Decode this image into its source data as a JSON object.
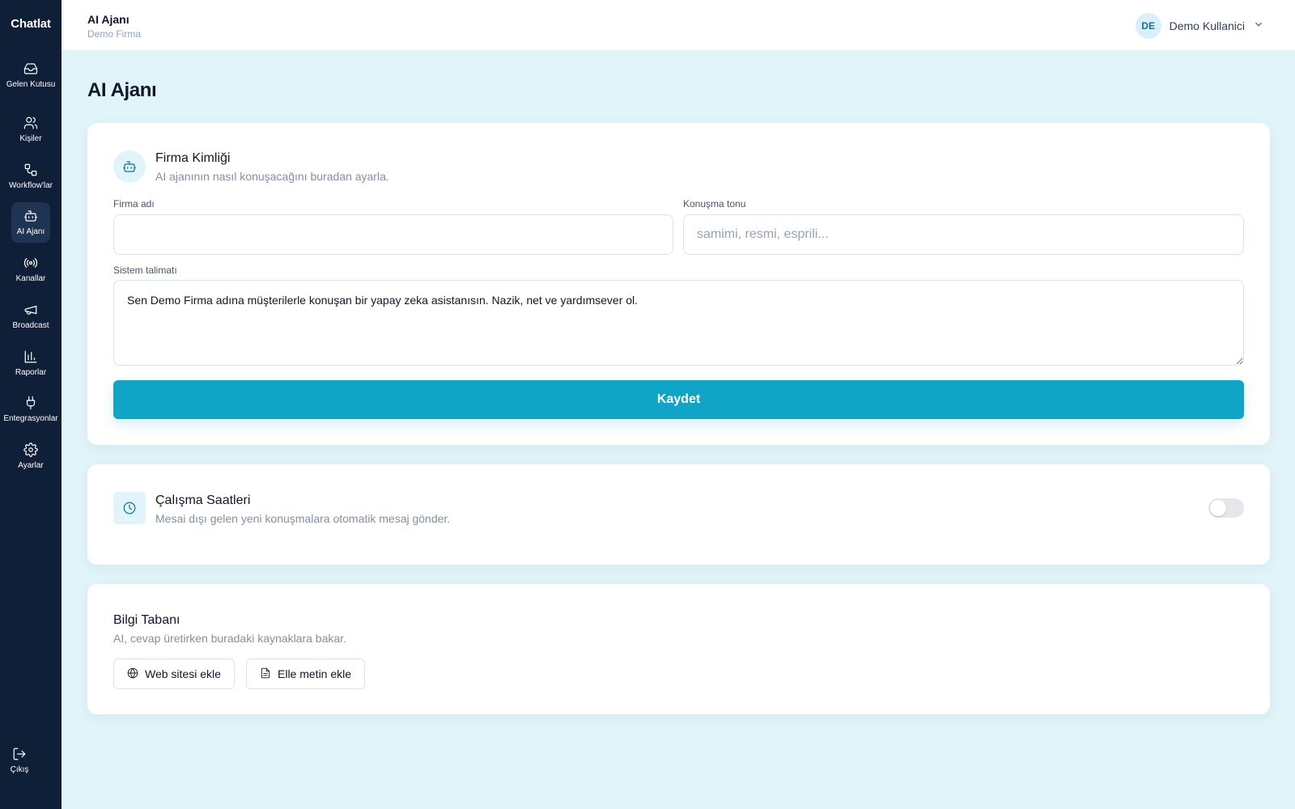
{
  "app": {
    "brand": "Chatlat"
  },
  "sidebar": {
    "items": [
      {
        "label": "Gelen Kutusu",
        "icon": "inbox-icon"
      },
      {
        "label": "Kişiler",
        "icon": "users-icon"
      },
      {
        "label": "Workflow'lar",
        "icon": "workflow-icon"
      },
      {
        "label": "AI Ajanı",
        "icon": "bot-icon",
        "active": true
      },
      {
        "label": "Kanallar",
        "icon": "radio-icon"
      },
      {
        "label": "Broadcast",
        "icon": "megaphone-icon"
      },
      {
        "label": "Raporlar",
        "icon": "bar-chart-icon"
      },
      {
        "label": "Entegrasyonlar",
        "icon": "plug-icon"
      },
      {
        "label": "Ayarlar",
        "icon": "gear-icon"
      }
    ],
    "logout": {
      "label": "Çıkış",
      "icon": "logout-icon"
    }
  },
  "header": {
    "title": "AI Ajanı",
    "subtitle": "Demo Firma",
    "user": {
      "initials": "DE",
      "name": "Demo Kullanici"
    }
  },
  "main": {
    "page_title": "AI Ajanı",
    "identity": {
      "title": "Firma Kimliği",
      "description": "AI ajanının nasıl konuşacağını buradan ayarla.",
      "company_name": {
        "label": "Firma adı",
        "value": "",
        "placeholder": ""
      },
      "tone": {
        "label": "Konuşma tonu",
        "value": "",
        "placeholder": "samimi, resmi, esprili..."
      },
      "system_prompt": {
        "label": "Sistem talimatı",
        "value": "Sen Demo Firma adına müşterilerle konuşan bir yapay zeka asistanısın. Nazik, net ve yardımsever ol."
      },
      "save_label": "Kaydet"
    },
    "working_hours": {
      "title": "Çalışma Saatleri",
      "description": "Mesai dışı gelen yeni konuşmalara otomatik mesaj gönder.",
      "enabled": false
    },
    "knowledge_base": {
      "title": "Bilgi Tabanı",
      "description": "AI, cevap üretirken buradaki kaynaklara bakar.",
      "add_website_label": "Web sitesi ekle",
      "add_text_label": "Elle metin ekle"
    }
  },
  "colors": {
    "sidebar": "#0f1f38",
    "accent": "#10a5c7",
    "background": "#e1f4fa"
  }
}
